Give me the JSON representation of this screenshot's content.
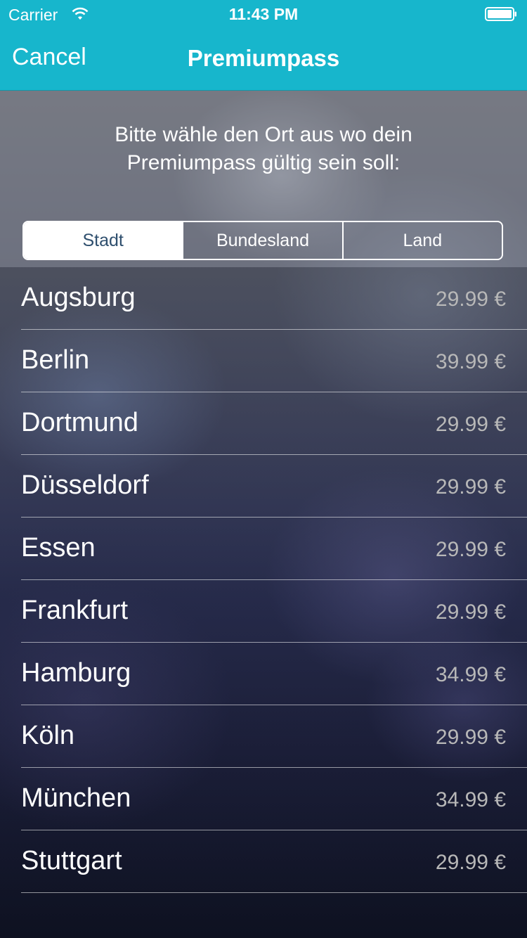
{
  "status_bar": {
    "carrier": "Carrier",
    "time": "11:43 PM"
  },
  "nav": {
    "cancel_label": "Cancel",
    "title": "Premiumpass"
  },
  "instructions": {
    "line1": "Bitte wähle den Ort aus wo dein",
    "line2": "Premiumpass gültig sein soll:"
  },
  "segments": [
    {
      "label": "Stadt",
      "selected": true
    },
    {
      "label": "Bundesland",
      "selected": false
    },
    {
      "label": "Land",
      "selected": false
    }
  ],
  "cities": [
    {
      "name": "Augsburg",
      "price": "29.99 €"
    },
    {
      "name": "Berlin",
      "price": "39.99 €"
    },
    {
      "name": "Dortmund",
      "price": "29.99 €"
    },
    {
      "name": "Düsseldorf",
      "price": "29.99 €"
    },
    {
      "name": "Essen",
      "price": "29.99 €"
    },
    {
      "name": "Frankfurt",
      "price": "29.99 €"
    },
    {
      "name": "Hamburg",
      "price": "34.99 €"
    },
    {
      "name": "Köln",
      "price": "29.99 €"
    },
    {
      "name": "München",
      "price": "34.99 €"
    },
    {
      "name": "Stuttgart",
      "price": "29.99 €"
    }
  ],
  "colors": {
    "nav_bar": "#17b6cc",
    "selected_segment_text": "#2f4f6e",
    "price_text": "#b8b8b8"
  },
  "icons": {
    "wifi": "wifi-icon",
    "battery": "battery-icon"
  }
}
